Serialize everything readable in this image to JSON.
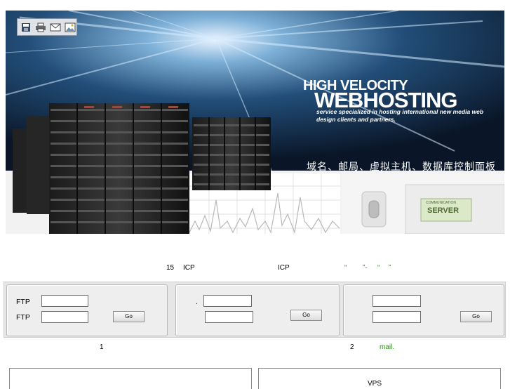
{
  "banner": {
    "title_line1": "HIGH VELOCITY",
    "title_line2": "WEBHOSTING",
    "subtitle": "service specialized in hosting international new media web design clients and partners.",
    "chinese_caption": "域名、邮局、虚拟主机、数据库控制面板",
    "device_label_top": "COMMUNICATION",
    "device_label_main": "SERVER",
    "toolbar": [
      "save-icon",
      "print-icon",
      "mail-icon",
      "photo-icon"
    ]
  },
  "notice": {
    "part1": "15",
    "part2": "ICP",
    "part3": "ICP",
    "part4": "“",
    "part5": "”-",
    "part6": "“",
    "part7": "”"
  },
  "panels": {
    "ftp": {
      "label1": "FTP",
      "label2": "FTP",
      "go": "Go"
    },
    "middle": {
      "mark": ".",
      "go": "Go"
    },
    "right": {
      "go": "Go"
    }
  },
  "footer": {
    "note1": "1",
    "note2": "2",
    "note2_link": "mail."
  },
  "bottom": {
    "right_title": "VPS"
  },
  "colors": {
    "accent_green": "#2a8a1a",
    "banner_dark": "#0e1e33"
  }
}
